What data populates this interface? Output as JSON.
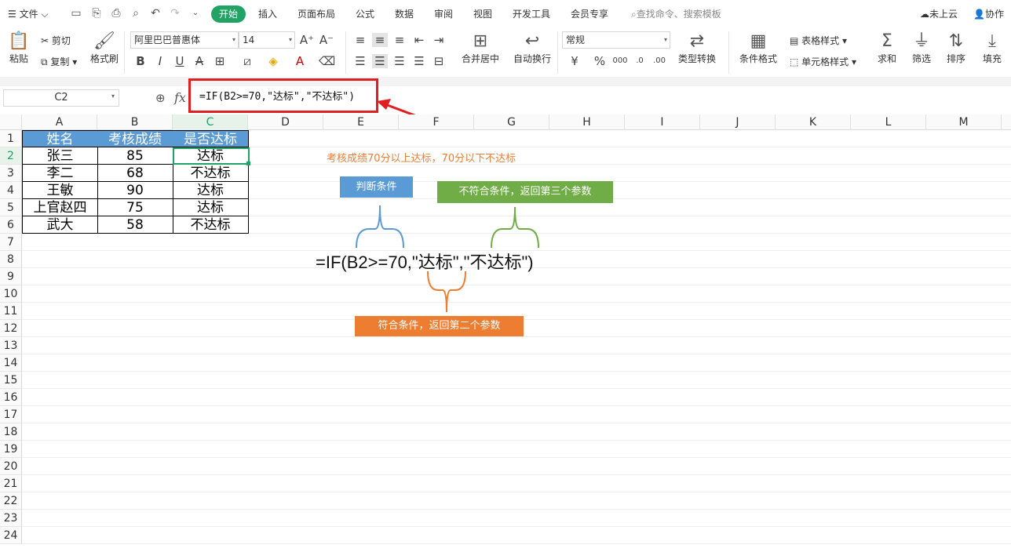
{
  "menu": {
    "file": "文件",
    "tabs": [
      "开始",
      "插入",
      "页面布局",
      "公式",
      "数据",
      "审阅",
      "视图",
      "开发工具",
      "会员专享"
    ],
    "search_placeholder": "查找命令、搜索模板",
    "cloud": "未上云",
    "collab": "协作"
  },
  "ribbon": {
    "paste": "粘贴",
    "cut": "剪切",
    "copy": "复制",
    "format_painter": "格式刷",
    "font_name": "阿里巴巴普惠体",
    "font_size": "14",
    "merge": "合并居中",
    "wrap": "自动换行",
    "number_format": "常规",
    "type_convert": "类型转换",
    "cond_format": "条件格式",
    "table_style": "表格样式",
    "cell_style": "单元格样式",
    "sum": "求和",
    "filter": "筛选",
    "sort": "排序",
    "fill": "填充"
  },
  "formula_bar": {
    "name_box": "C2",
    "fx": "fx",
    "formula": "=IF(B2>=70,\"达标\",\"不达标\")"
  },
  "columns": [
    "A",
    "B",
    "C",
    "D",
    "E",
    "F",
    "G",
    "H",
    "I",
    "J",
    "K",
    "L",
    "M"
  ],
  "rows": [
    "1",
    "2",
    "3",
    "4",
    "5",
    "6",
    "7",
    "8",
    "9",
    "10",
    "11",
    "12",
    "13",
    "14",
    "15",
    "16",
    "17",
    "18",
    "19",
    "20",
    "21",
    "22",
    "23",
    "24"
  ],
  "table": {
    "headers": [
      "姓名",
      "考核成绩",
      "是否达标"
    ],
    "rows": [
      [
        "张三",
        "85",
        "达标"
      ],
      [
        "李二",
        "68",
        "不达标"
      ],
      [
        "王敏",
        "90",
        "达标"
      ],
      [
        "上官赵四",
        "75",
        "达标"
      ],
      [
        "武大",
        "58",
        "不达标"
      ]
    ]
  },
  "annotation": {
    "note": "考核成绩70分以上达标，70分以下不达标",
    "condition": "判断条件",
    "false_box": "不符合条件，返回第三个参数",
    "true_box": "符合条件，返回第二个参数",
    "formula": "=IF(B2>=70,\"达标\",\"不达标\")"
  },
  "colors": {
    "accent": "#21a366",
    "header_fill": "#5b9bd5",
    "cond_box": "#5b9bd5",
    "false_box": "#70ad47",
    "true_box": "#ed7d31",
    "note_text": "#ed7d31",
    "callout": "#e02020"
  }
}
